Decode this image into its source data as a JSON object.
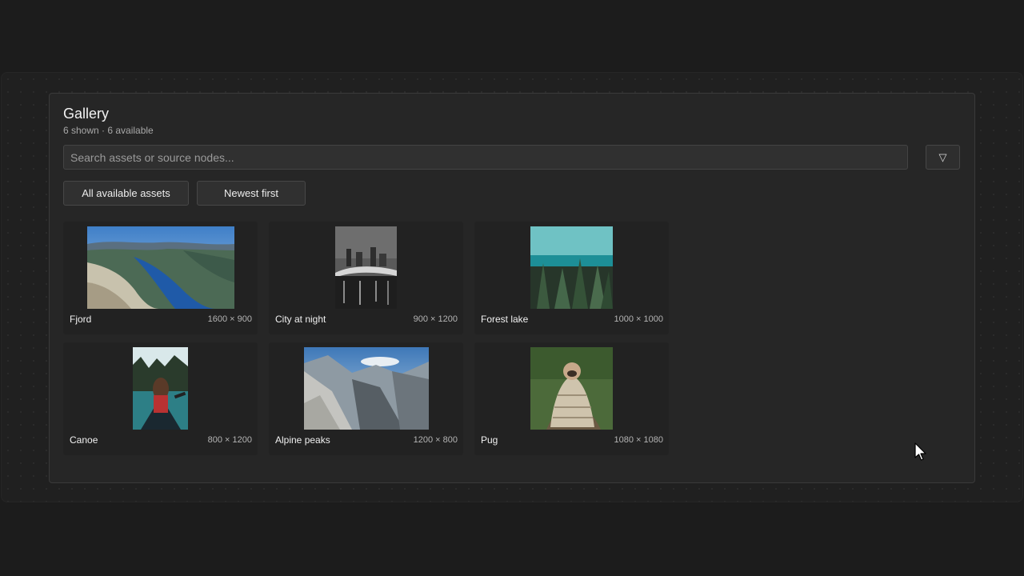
{
  "gallery": {
    "title": "Gallery",
    "subtitle": "6 shown · 6 available",
    "search_placeholder": "Search assets or source nodes...",
    "filter_icon": "▽",
    "scope_label": "All available assets",
    "sort_label": "Newest first"
  },
  "assets": [
    {
      "name": "Fjord",
      "dims": "1600 × 900"
    },
    {
      "name": "City at night",
      "dims": "900 × 1200"
    },
    {
      "name": "Forest lake",
      "dims": "1000 × 1000"
    },
    {
      "name": "Canoe",
      "dims": "800 × 1200"
    },
    {
      "name": "Alpine peaks",
      "dims": "1200 × 800"
    },
    {
      "name": "Pug",
      "dims": "1080 × 1080"
    }
  ]
}
